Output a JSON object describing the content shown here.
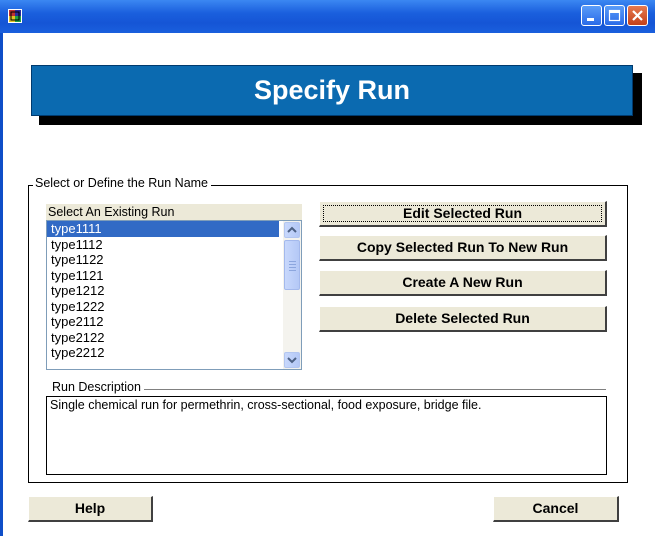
{
  "window": {
    "title": "",
    "controls": [
      "minimize-icon",
      "maximize-icon",
      "close-icon"
    ]
  },
  "banner": {
    "title": "Specify Run"
  },
  "run_group": {
    "legend": "Select or Define the Run Name",
    "list_label": "Select An Existing Run",
    "runs": [
      "type1111",
      "type1112",
      "type1122",
      "type1121",
      "type1212",
      "type1222",
      "type2112",
      "type2122",
      "type2212"
    ],
    "selected_run": "type1111"
  },
  "buttons": {
    "edit": "Edit Selected Run",
    "copy": "Copy Selected Run To New Run",
    "create": "Create A New Run",
    "delete": "Delete Selected Run",
    "help": "Help",
    "cancel": "Cancel"
  },
  "description": {
    "label": "Run Description",
    "text": "Single chemical run for permethrin, cross-sectional, food exposure, bridge file."
  },
  "colors": {
    "titlebar": "#1a5fdd",
    "banner": "#0b6ab0",
    "selection": "#316ac5",
    "button_face": "#ece9d8"
  }
}
